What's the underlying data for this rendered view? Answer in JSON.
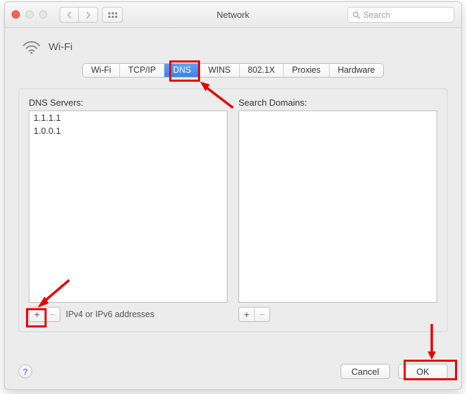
{
  "window": {
    "title": "Network"
  },
  "search": {
    "placeholder": "Search"
  },
  "interface": {
    "name": "Wi-Fi"
  },
  "tabs": [
    {
      "id": "wifi",
      "label": "Wi-Fi",
      "active": false
    },
    {
      "id": "tcpip",
      "label": "TCP/IP",
      "active": false
    },
    {
      "id": "dns",
      "label": "DNS",
      "active": true
    },
    {
      "id": "wins",
      "label": "WINS",
      "active": false
    },
    {
      "id": "8021x",
      "label": "802.1X",
      "active": false
    },
    {
      "id": "proxies",
      "label": "Proxies",
      "active": false
    },
    {
      "id": "hardware",
      "label": "Hardware",
      "active": false
    }
  ],
  "dns": {
    "servers_label": "DNS Servers:",
    "servers": [
      "1.1.1.1",
      "1.0.0.1"
    ],
    "domains_label": "Search Domains:",
    "domains": [],
    "hint": "IPv4 or IPv6 addresses"
  },
  "buttons": {
    "cancel": "Cancel",
    "ok": "OK",
    "add": "+",
    "remove": "−"
  },
  "annotations": {
    "highlight_tab": "dns",
    "highlight_add": true,
    "highlight_ok": true
  }
}
